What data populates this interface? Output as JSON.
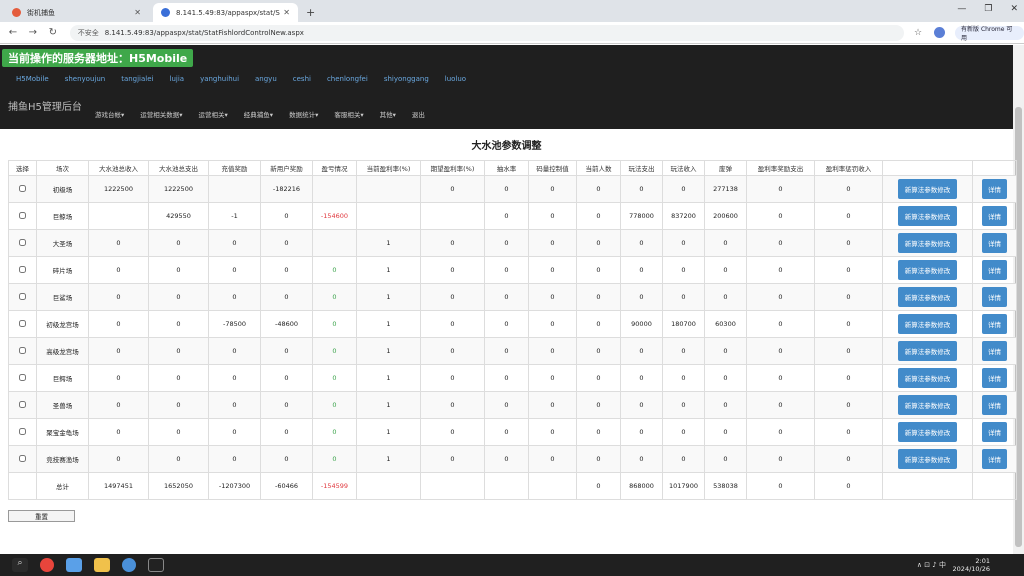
{
  "browser": {
    "tabs": [
      {
        "title": "街机捕鱼"
      },
      {
        "title": "8.141.5.49:83/appaspx/stat/S"
      }
    ],
    "insecure": "不安全",
    "url": "8.141.5.49:83/appaspx/stat/StatFishlordControlNew.aspx",
    "update_button": "有新版 Chrome 可用"
  },
  "header": {
    "server_title": "当前操作的服务器地址：H5Mobile",
    "servers": [
      "H5Mobile",
      "shenyoujun",
      "tangjialei",
      "lujia",
      "yanghuihui",
      "angyu",
      "ceshi",
      "chenlongfei",
      "shiyonggang",
      "luoluo"
    ],
    "brand": "捕鱼H5管理后台",
    "menus": [
      "游戏台帐",
      "运营相关数据",
      "运营相关",
      "经典捕鱼",
      "数据统计",
      "客服相关",
      "其他",
      "退出"
    ]
  },
  "page": {
    "title": "大水池参数调整",
    "headers": [
      "选择",
      "场次",
      "大水池总收入",
      "大水池总支出",
      "充值奖励",
      "新用户奖励",
      "盈亏情况",
      "当前盈利率(%)",
      "期望盈利率(%)",
      "抽水率",
      "码量控制值",
      "当前人数",
      "玩法支出",
      "玩法收入",
      "废弹",
      "盈利率奖励支出",
      "盈利率惩罚收入",
      "",
      ""
    ],
    "rows": [
      {
        "name": "初级场",
        "c": [
          "1222500",
          "1222500",
          "",
          "-182216",
          "",
          "",
          "0",
          "0",
          "0",
          "0",
          "0",
          "0",
          "277138",
          "0",
          "0"
        ]
      },
      {
        "name": "巨鲸场",
        "c": [
          "",
          "429550",
          "-1",
          "0",
          "-154600",
          "",
          "",
          "0",
          "0",
          "0",
          "778000",
          "837200",
          "200600",
          "0",
          "0"
        ]
      },
      {
        "name": "大圣场",
        "c": [
          "0",
          "0",
          "0",
          "0",
          "",
          "1",
          "0",
          "0",
          "0",
          "0",
          "0",
          "0",
          "0",
          "0",
          "0"
        ]
      },
      {
        "name": "碎片场",
        "c": [
          "0",
          "0",
          "0",
          "0",
          "0",
          "1",
          "0",
          "0",
          "0",
          "0",
          "0",
          "0",
          "0",
          "0",
          "0"
        ]
      },
      {
        "name": "巨鲨场",
        "c": [
          "0",
          "0",
          "0",
          "0",
          "0",
          "1",
          "0",
          "0",
          "0",
          "0",
          "0",
          "0",
          "0",
          "0",
          "0"
        ]
      },
      {
        "name": "初级龙宫场",
        "c": [
          "0",
          "0",
          "-78500",
          "-48600",
          "0",
          "1",
          "0",
          "0",
          "0",
          "0",
          "90000",
          "180700",
          "60300",
          "0",
          "0"
        ]
      },
      {
        "name": "高级龙宫场",
        "c": [
          "0",
          "0",
          "0",
          "0",
          "0",
          "1",
          "0",
          "0",
          "0",
          "0",
          "0",
          "0",
          "0",
          "0",
          "0"
        ]
      },
      {
        "name": "巨鳄场",
        "c": [
          "0",
          "0",
          "0",
          "0",
          "0",
          "1",
          "0",
          "0",
          "0",
          "0",
          "0",
          "0",
          "0",
          "0",
          "0"
        ]
      },
      {
        "name": "圣兽场",
        "c": [
          "0",
          "0",
          "0",
          "0",
          "0",
          "1",
          "0",
          "0",
          "0",
          "0",
          "0",
          "0",
          "0",
          "0",
          "0"
        ]
      },
      {
        "name": "聚宝金龟场",
        "c": [
          "0",
          "0",
          "0",
          "0",
          "0",
          "1",
          "0",
          "0",
          "0",
          "0",
          "0",
          "0",
          "0",
          "0",
          "0"
        ]
      },
      {
        "name": "竞技赛渔场",
        "c": [
          "0",
          "0",
          "0",
          "0",
          "0",
          "1",
          "0",
          "0",
          "0",
          "0",
          "0",
          "0",
          "0",
          "0",
          "0"
        ]
      }
    ],
    "total_label": "总计",
    "totals": [
      "1497451",
      "1652050",
      "-1207300",
      "-60466",
      "-154599",
      "",
      "",
      "",
      "",
      "0",
      "868000",
      "1017900",
      "538038",
      "0",
      "0"
    ],
    "edit_button": "新算法参数修改",
    "detail_button": "详情",
    "reset_button": "重置"
  },
  "taskbar": {
    "time": "2:01",
    "date": "2024/10/26",
    "lang": "中"
  }
}
